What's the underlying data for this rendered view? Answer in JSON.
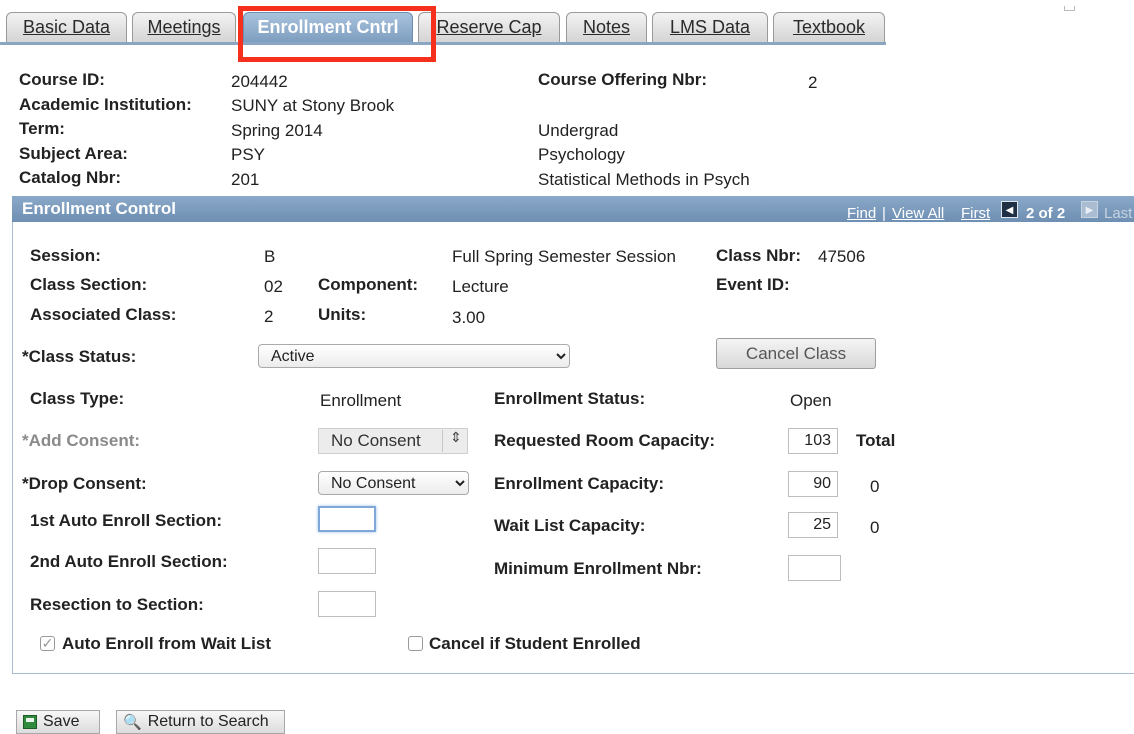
{
  "tabs": [
    {
      "label": "Basic Data"
    },
    {
      "label": "Meetings"
    },
    {
      "label": "Enrollment Cntrl"
    },
    {
      "label": "Reserve Cap"
    },
    {
      "label": "Notes"
    },
    {
      "label": "LMS Data"
    },
    {
      "label": "Textbook"
    }
  ],
  "header": {
    "course_id_label": "Course ID:",
    "course_id": "204442",
    "institution_label": "Academic Institution:",
    "institution": "SUNY at Stony Brook",
    "term_label": "Term:",
    "term": "Spring 2014",
    "term_career": "Undergrad",
    "subject_label": "Subject Area:",
    "subject": "PSY",
    "subject_desc": "Psychology",
    "catalog_label": "Catalog Nbr:",
    "catalog": "201",
    "catalog_desc": "Statistical Methods in Psych",
    "offering_label": "Course Offering Nbr:",
    "offering": "2"
  },
  "panel": {
    "title": "Enrollment Control",
    "nav": {
      "find": "Find",
      "sep": "|",
      "view_all": "View All",
      "first": "First",
      "count": "2 of 2",
      "last": "Last",
      "prev_icon": "arrow-left-icon",
      "next_icon": "arrow-right-icon"
    }
  },
  "fields": {
    "session_label": "Session:",
    "session": "B",
    "session_desc": "Full Spring Semester Session",
    "class_nbr_label": "Class Nbr:",
    "class_nbr": "47506",
    "class_section_label": "Class Section:",
    "class_section": "02",
    "component_label": "Component:",
    "component": "Lecture",
    "event_id_label": "Event ID:",
    "associated_label": "Associated Class:",
    "associated": "2",
    "units_label": "Units:",
    "units": "3.00",
    "class_status_label": "*Class Status:",
    "class_status": "Active",
    "cancel_button": "Cancel Class",
    "class_type_label": "Class Type:",
    "class_type": "Enrollment",
    "enroll_status_label": "Enrollment Status:",
    "enroll_status": "Open",
    "add_consent_label": "*Add Consent:",
    "add_consent": "No Consent",
    "req_room_label": "Requested Room Capacity:",
    "req_room": "103",
    "total_label": "Total",
    "drop_consent_label": "*Drop Consent:",
    "drop_consent": "No Consent",
    "enroll_cap_label": "Enrollment Capacity:",
    "enroll_cap": "90",
    "enroll_total": "0",
    "auto1_label": "1st Auto Enroll Section:",
    "wait_cap_label": "Wait List Capacity:",
    "wait_cap": "25",
    "wait_total": "0",
    "auto2_label": "2nd Auto Enroll Section:",
    "min_enroll_label": "Minimum Enrollment Nbr:",
    "resection_label": "Resection to Section:",
    "auto_enroll_wait_label": "Auto Enroll from Wait List",
    "cancel_if_enrolled_label": "Cancel if Student Enrolled"
  },
  "footer": {
    "save": "Save",
    "return": "Return to Search",
    "save_icon": "save-icon",
    "return_icon": "search-icon"
  },
  "colors": {
    "tab_active": "#7e9ec0",
    "panel_bar": "#7394b8",
    "highlight": "#f5301d"
  }
}
